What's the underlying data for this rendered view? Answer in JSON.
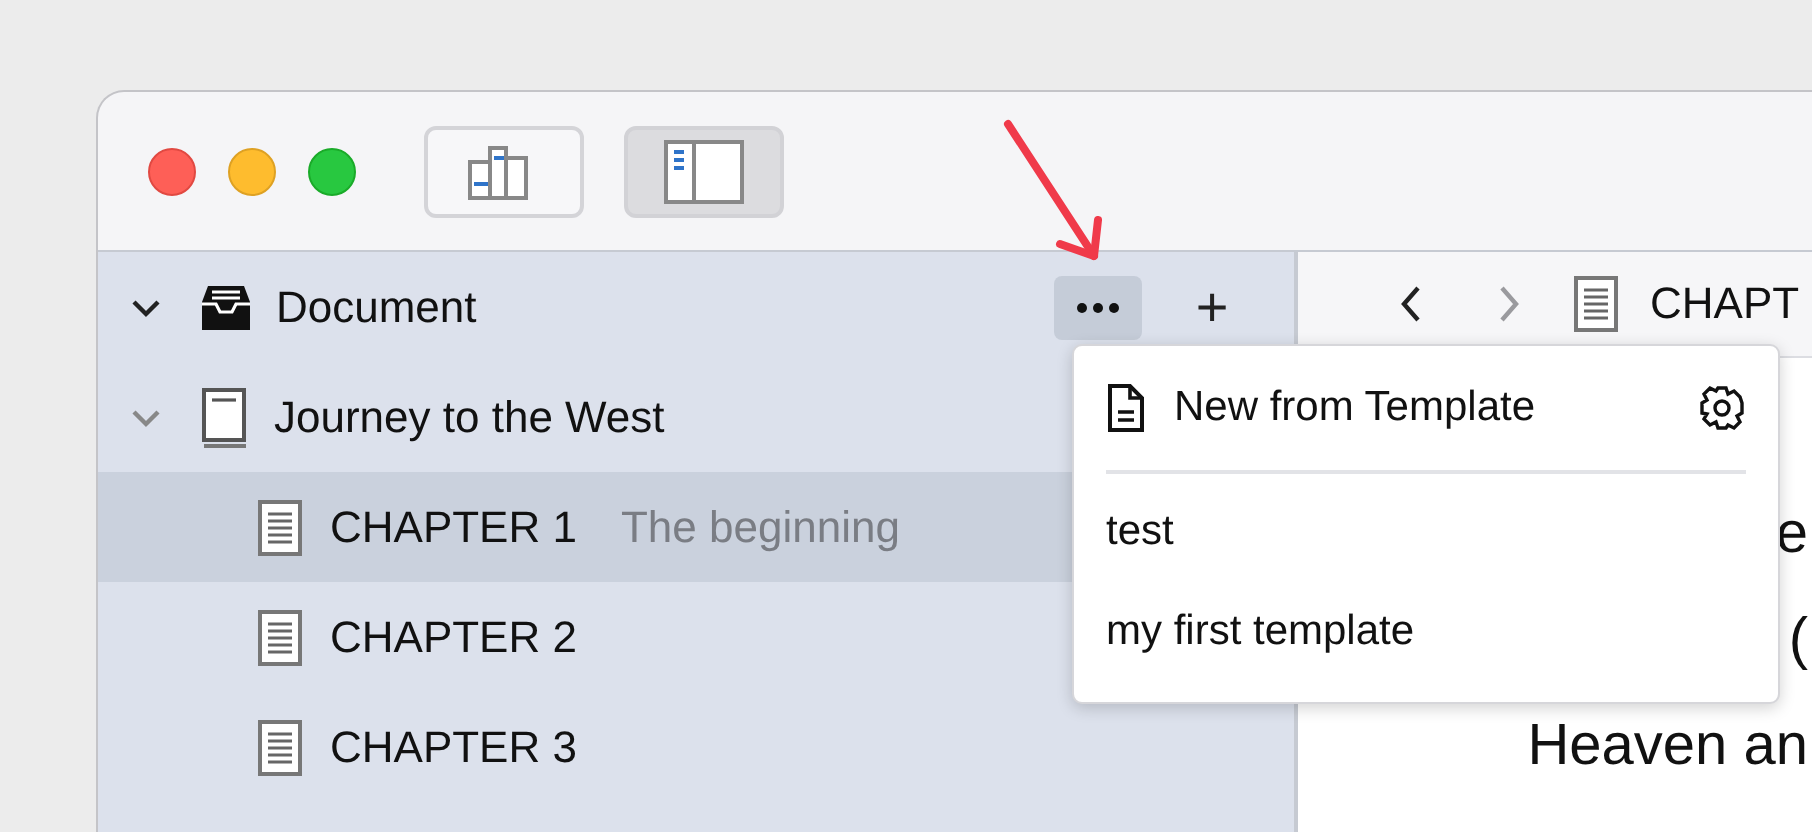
{
  "toolbar": {
    "buttons": [
      {
        "kind": "stats",
        "selected": false
      },
      {
        "kind": "sidebar",
        "selected": true
      }
    ]
  },
  "sidebar": {
    "root": {
      "label": "Document",
      "expanded": true
    },
    "add_button": "+",
    "tree": [
      {
        "label": "Journey to the West",
        "kind": "book",
        "expanded": true,
        "selected": false,
        "children": [
          {
            "label": "CHAPTER 1",
            "subtitle": "The beginning",
            "kind": "page",
            "selected": true
          },
          {
            "label": "CHAPTER 2",
            "kind": "page",
            "selected": false
          },
          {
            "label": "CHAPTER 3",
            "kind": "page",
            "selected": false
          }
        ]
      }
    ]
  },
  "editor": {
    "nav": [
      {
        "kind": "back",
        "disabled": false
      },
      {
        "kind": "forward",
        "disabled": true
      }
    ],
    "title": "CHAPT",
    "lines": [
      "e",
      "(",
      "Heaven an"
    ]
  },
  "menu": {
    "header": "New from Template",
    "items": [
      {
        "label": "test"
      },
      {
        "label": "my first template"
      }
    ]
  }
}
